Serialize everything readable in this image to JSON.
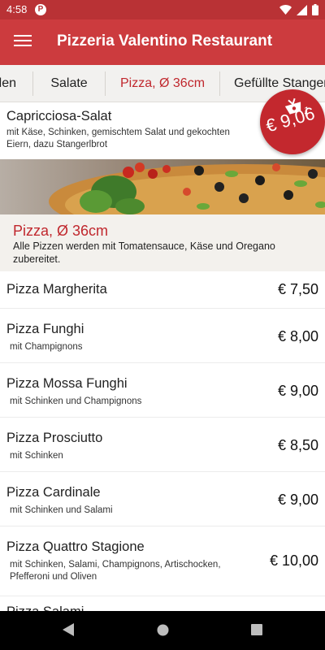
{
  "status_bar": {
    "time": "4:58",
    "app_icon_label": "P"
  },
  "app_bar": {
    "title": "Pizzeria Valentino Restaurant",
    "menu_icon": "hamburger-menu-icon"
  },
  "tabs": [
    {
      "label": "Pizza-Rollen"
    },
    {
      "label": "Salate"
    },
    {
      "label": "Pizza, Ø 36cm"
    },
    {
      "label": "Gefüllte Stangen"
    }
  ],
  "previous_item": {
    "name": "Capricciosa-Salat",
    "description": "mit Käse, Schinken, gemischtem Salat und gekochten Eiern, dazu Stangerlbrot"
  },
  "section": {
    "title": "Pizza, Ø 36cm",
    "description": "Alle Pizzen werden mit Tomatensauce, Käse und Oregano zubereitet."
  },
  "items": [
    {
      "name": "Pizza Margherita",
      "description": "",
      "price": "€ 7,50"
    },
    {
      "name": "Pizza Funghi",
      "description": "mit Champignons",
      "price": "€ 8,00"
    },
    {
      "name": "Pizza Mossa Funghi",
      "description": "mit Schinken und Champignons",
      "price": "€ 9,00"
    },
    {
      "name": "Pizza Prosciutto",
      "description": "mit Schinken",
      "price": "€ 8,50"
    },
    {
      "name": "Pizza Cardinale",
      "description": "mit Schinken und Salami",
      "price": "€ 9,00"
    },
    {
      "name": "Pizza Quattro Stagione",
      "description": "mit Schinken, Salami, Champignons, Artischocken, Pfefferoni und Oliven",
      "price": "€ 10,00"
    },
    {
      "name": "Pizza Salami",
      "description": "",
      "price": ""
    }
  ],
  "cart": {
    "count": "1",
    "total": "€ 9,06",
    "icon": "shopping-basket-icon"
  },
  "colors": {
    "primary": "#cc3b3e",
    "status": "#b93235",
    "accent": "#c0272d",
    "section_bg": "#f3f1ed"
  }
}
